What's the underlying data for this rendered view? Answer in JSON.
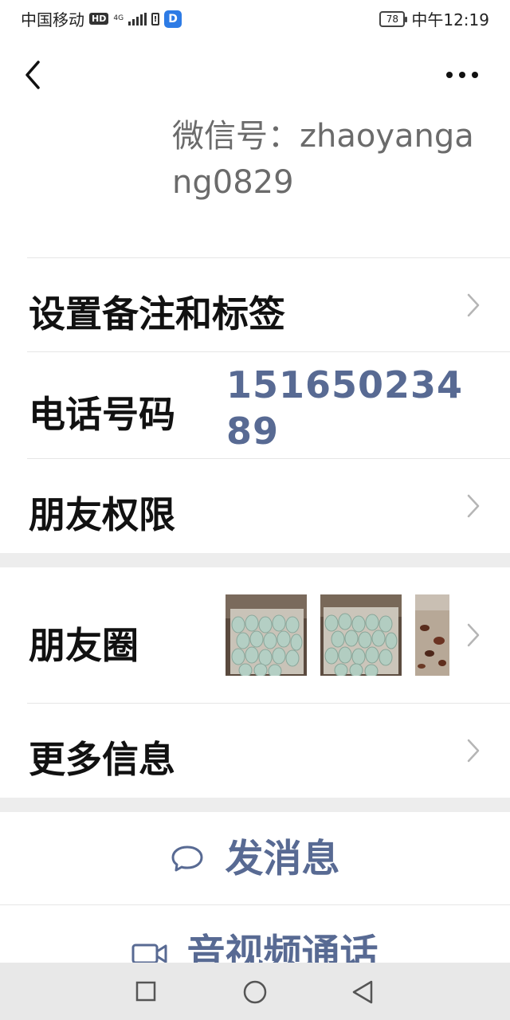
{
  "status_bar": {
    "carrier": "中国移动",
    "hd": "HD",
    "network": "4G",
    "battery_level": "78",
    "time": "中午12:19",
    "app_badge_letter": "D"
  },
  "profile": {
    "wechat_id_text": "微信号：zhaoyangang0829"
  },
  "rows": {
    "remark_label": "设置备注和标签",
    "phone_label": "电话号码",
    "phone_number": "15165023489",
    "friend_perm_label": "朋友权限",
    "moments_label": "朋友圈",
    "more_info_label": "更多信息"
  },
  "actions": {
    "message_label": "发消息",
    "video_call_label": "音视频通话"
  },
  "colors": {
    "link_blue": "#586a93",
    "band_gray": "#ededed"
  },
  "icons": {
    "back": "back-chevron-icon",
    "more": "more-dots-icon",
    "chevron": "chevron-right-icon",
    "chat": "chat-bubble-icon",
    "video": "video-camera-icon"
  }
}
